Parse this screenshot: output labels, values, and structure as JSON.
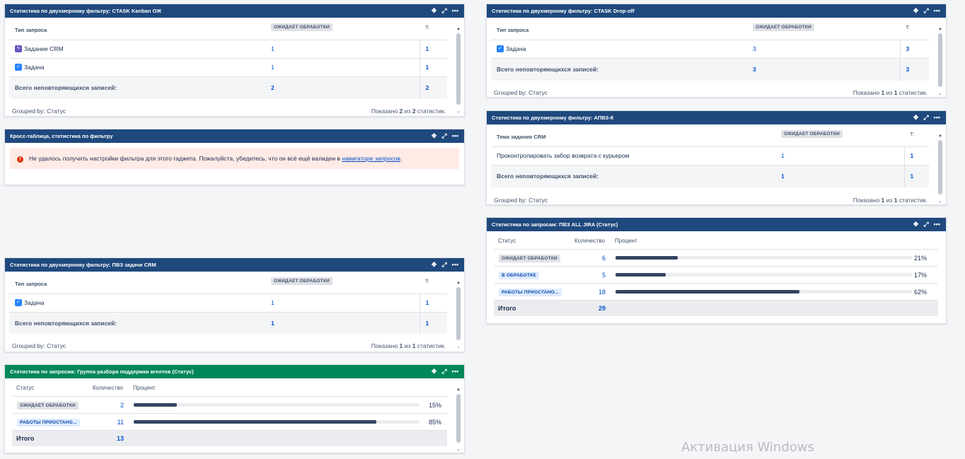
{
  "g1": {
    "title": "Статистика по двухмерному фильтру: CTASK Kanban ОЖ",
    "col_type": "Тип запроса",
    "col_status": "ОЖИДАЕТ ОБРАБОТКИ",
    "col_t": "T:",
    "rows": [
      {
        "label": "Задание CRM",
        "icon": "lightning-icon",
        "v1": "1",
        "v2": "1"
      },
      {
        "label": "Задача",
        "icon": "task-check-icon",
        "v1": "1",
        "v2": "1"
      }
    ],
    "total_label": "Всего неповторяющихся записей:",
    "total_v1": "2",
    "total_v2": "2",
    "grouped": "Grouped by: Статус",
    "shown_pre": "Показано",
    "shown_a": "2",
    "shown_mid": "из",
    "shown_b": "2",
    "shown_post": "статистик."
  },
  "g2": {
    "title": "Кросс-таблица, статистика по фильтру",
    "error_text": "Не удалось получить настройки фильтра для этого гаджета. Пожалуйста, убедитесь, что он всё ещё валиден в",
    "error_link": "навигаторе запросов",
    "error_end": "."
  },
  "g3": {
    "title": "Статистика по двухмерному фильтру: ПВЗ задачи CRM",
    "col_type": "Тип запроса",
    "col_status": "ОЖИДАЕТ ОБРАБОТКИ",
    "col_t": "T:",
    "row_label": "Задача",
    "row_v1": "1",
    "row_v2": "1",
    "total_label": "Всего неповторяющихся записей:",
    "total_v1": "1",
    "total_v2": "1",
    "grouped": "Grouped by: Статус",
    "shown_pre": "Показано",
    "shown_a": "1",
    "shown_mid": "из",
    "shown_b": "1",
    "shown_post": "статистик."
  },
  "g4": {
    "title": "Статистика по запросам: Группа разбора поддержки агентов (Статус)",
    "col_status": "Статус",
    "col_count": "Количество",
    "col_pct": "Процент",
    "rows": [
      {
        "status": "ОЖИДАЕТ ОБРАБОТКИ",
        "count": "2",
        "pct": "15%",
        "fraction": 0.15
      },
      {
        "status": "РАБОТЫ ПРИОСТАНО...",
        "count": "11",
        "pct": "85%",
        "fraction": 0.85
      }
    ],
    "total_label": "Итого",
    "total": "13"
  },
  "g5": {
    "title": "Статистика по двухмерному фильтру: CTASK Drop-off",
    "col_type": "Тип запроса",
    "col_status": "ОЖИДАЕТ ОБРАБОТКИ",
    "col_t": "T:",
    "row_label": "Задача",
    "row_v1": "3",
    "row_v2": "3",
    "total_label": "Всего неповторяющихся записей:",
    "total_v1": "3",
    "total_v2": "3",
    "grouped": "Grouped by: Статус",
    "shown_pre": "Показано",
    "shown_a": "1",
    "shown_mid": "из",
    "shown_b": "1",
    "shown_post": "статистик."
  },
  "g6": {
    "title": "Статистика по двухмерному фильтру: АПВЗ-К",
    "col_type": "Тема задания CRM",
    "col_status": "ОЖИДАЕТ ОБРАБОТКИ",
    "col_t": "T:",
    "row_label": "Проконтролировать забор возврата с курьером",
    "row_v1": "1",
    "row_v2": "1",
    "total_label": "Всего неповторяющихся записей:",
    "total_v1": "1",
    "total_v2": "1",
    "grouped": "Grouped by: Статус",
    "shown_pre": "Показано",
    "shown_a": "1",
    "shown_mid": "из",
    "shown_b": "1",
    "shown_post": "статистик."
  },
  "g7": {
    "title": "Статистика по запросам: ПВЗ ALL JIRA (Статус)",
    "col_status": "Статус",
    "col_count": "Количество",
    "col_pct": "Процент",
    "rows": [
      {
        "status": "ОЖИДАЕТ ОБРАБОТКИ",
        "count": "6",
        "pct": "21%",
        "fraction": 0.21
      },
      {
        "status": "В ОБРАБОТКЕ",
        "count": "5",
        "pct": "17%",
        "fraction": 0.17
      },
      {
        "status": "РАБОТЫ ПРИОСТАНО...",
        "count": "18",
        "pct": "62%",
        "fraction": 0.62
      }
    ],
    "total_label": "Итого",
    "total": "29"
  },
  "watermark": "Активация Windows",
  "icons": {
    "move": "move-icon",
    "expand": "expand-icon",
    "more": "more-icon"
  }
}
